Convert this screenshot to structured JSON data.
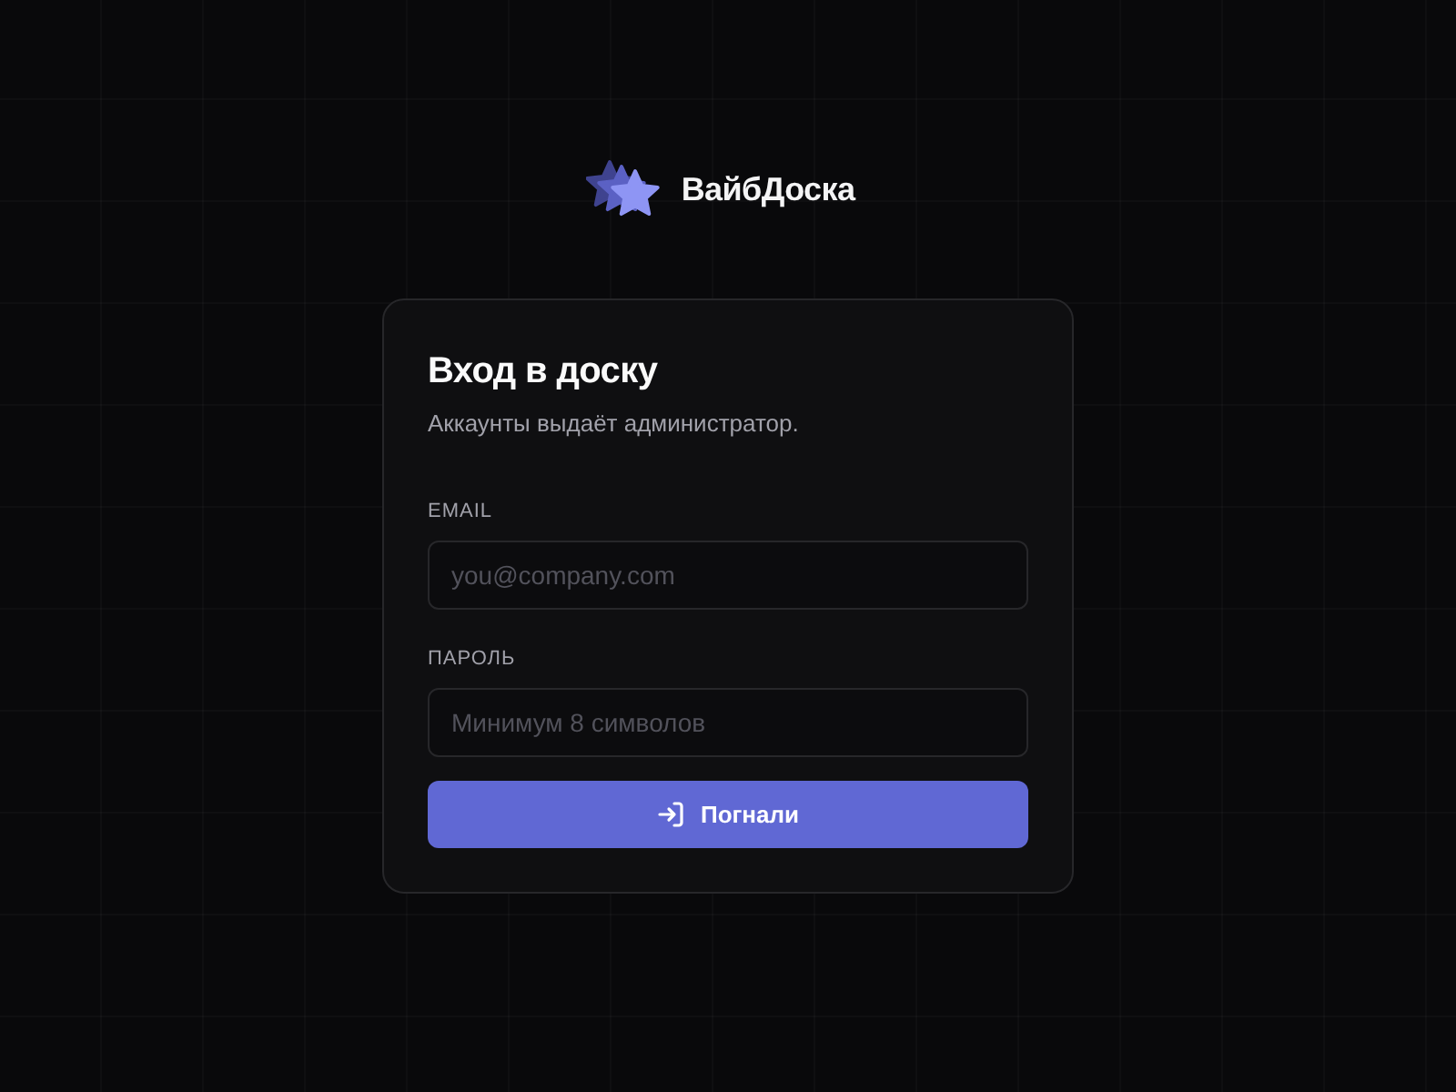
{
  "brand": {
    "name": "ВайбДоска"
  },
  "login_card": {
    "title": "Вход в доску",
    "subtitle": "Аккаунты выдаёт администратор.",
    "fields": [
      {
        "label": "EMAIL",
        "placeholder": "you@company.com"
      },
      {
        "label": "ПАРОЛЬ",
        "placeholder": "Минимум 8 символов"
      }
    ],
    "submit_button": {
      "label": "Погнали"
    }
  }
}
